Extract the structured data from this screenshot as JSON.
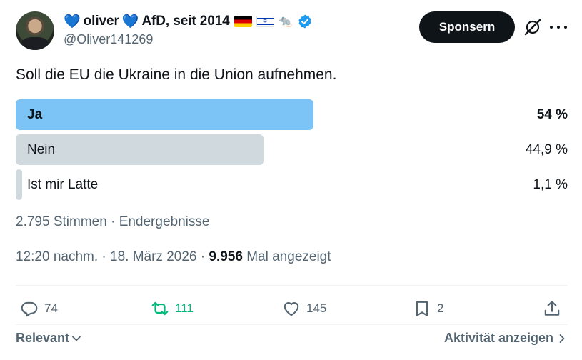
{
  "tweet": {
    "display_name": "oliver",
    "display_name_suffix": "AfD, seit 2014",
    "handle": "@Oliver141269",
    "sponsor_label": "Sponsern",
    "question": "Soll die EU die Ukraine in die Union aufnehmen."
  },
  "poll": {
    "options": [
      {
        "label": "Ja",
        "percent": "54 %",
        "share": 0.54,
        "winner": true,
        "color": "#7cc4f5"
      },
      {
        "label": "Nein",
        "percent": "44,9 %",
        "share": 0.449,
        "winner": false,
        "color": "#cfd9de"
      },
      {
        "label": "Ist mir Latte",
        "percent": "1,1 %",
        "share": 0.011,
        "winner": false,
        "color": "#cfd9de"
      }
    ],
    "votes": "2.795 Stimmen",
    "status": "Endergebnisse"
  },
  "meta": {
    "time": "12:20 nachm.",
    "date": "18. März 2026",
    "views": "9.956",
    "views_label": "Mal angezeigt"
  },
  "actions": {
    "replies": "74",
    "reposts": "111",
    "likes": "145",
    "bookmarks": "2"
  },
  "footer": {
    "sort_label": "Relevant",
    "activity_label": "Aktivität anzeigen"
  },
  "colors": {
    "accent": "#1d9bf0",
    "repost": "#00ba7c",
    "secondary_text": "#536471",
    "primary_text": "#0f1419"
  }
}
